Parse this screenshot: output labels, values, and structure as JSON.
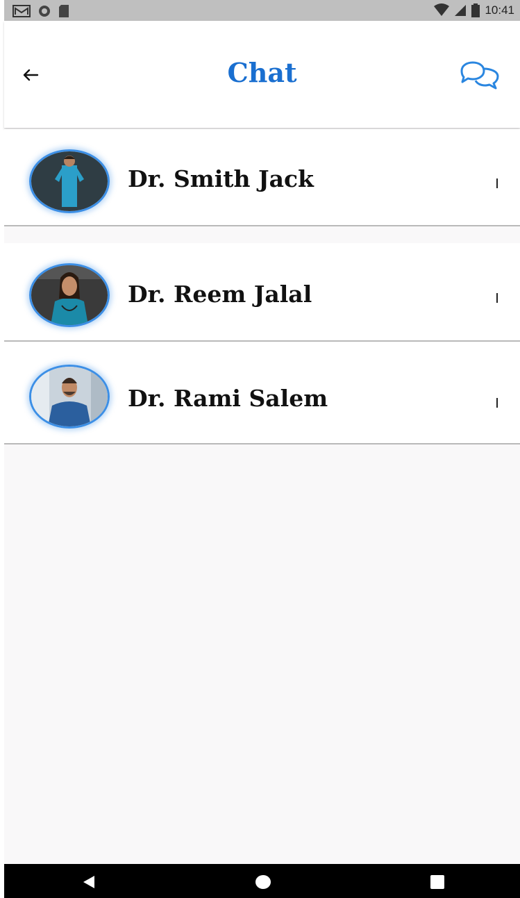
{
  "status_bar": {
    "time": "10:41",
    "left_icons": [
      "gmail-icon",
      "circle-icon",
      "sd-card-icon"
    ],
    "right_icons": [
      "wifi-icon",
      "signal-icon",
      "battery-icon"
    ]
  },
  "header": {
    "title": "Chat",
    "back_icon": "arrow-left-icon",
    "action_icon": "chat-bubbles-icon",
    "accent_color": "#1a6fd0"
  },
  "doctors": [
    {
      "name": "Dr. Smith Jack",
      "scrub_color": "#2b9fc9",
      "background": "#2f3d44"
    },
    {
      "name": "Dr. Reem Jalal",
      "scrub_color": "#1b8aa8",
      "background": "#3a3a3a"
    },
    {
      "name": "Dr. Rami Salem",
      "scrub_color": "#2b5f9e",
      "background": "#c9d3dc"
    }
  ],
  "nav_bar": {
    "icons": [
      "back-triangle-icon",
      "home-circle-icon",
      "recents-square-icon"
    ]
  }
}
